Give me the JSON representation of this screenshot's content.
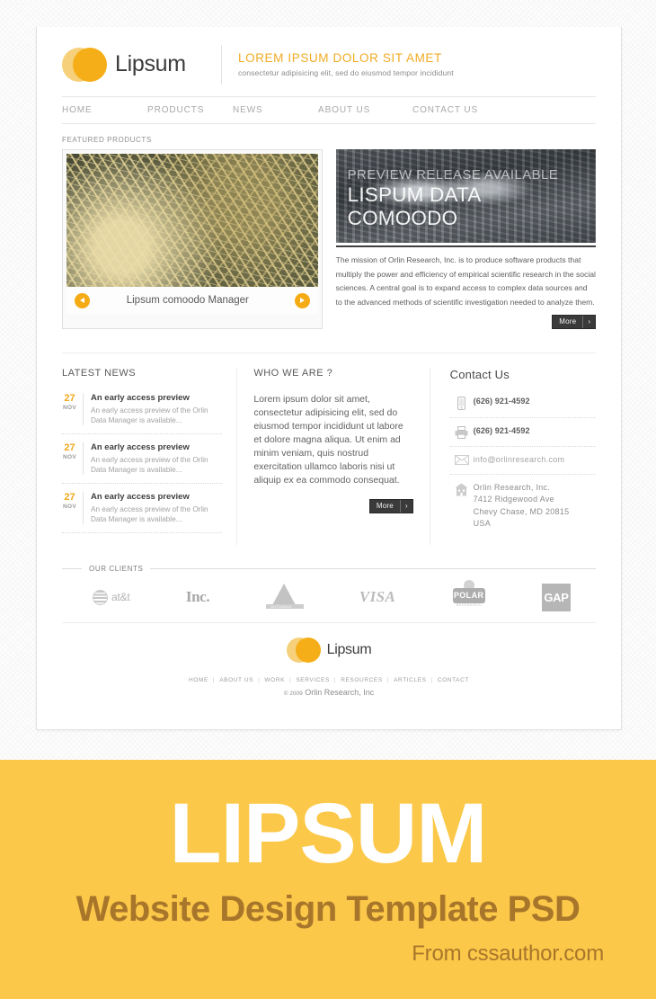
{
  "brand": {
    "name": "Lipsum"
  },
  "header": {
    "tagline_main": "LOREM IPSUM DOLOR SIT AMET",
    "tagline_sub": "consectetur adipisicing elit, sed do eiusmod tempor incididunt",
    "accent_color": "#efa81e"
  },
  "nav": {
    "items": [
      {
        "label": "HOME"
      },
      {
        "label": "PRODUCTS"
      },
      {
        "label": "NEWS"
      },
      {
        "label": "ABOUT US"
      },
      {
        "label": "CONTACT US"
      }
    ]
  },
  "featured": {
    "section_label": "FEATURED PRODUCTS",
    "slider": {
      "caption": "Lipsum comoodo Manager"
    },
    "promo": {
      "overline": "PREVIEW RELEASE AVAILABLE",
      "title_line1": "LISPUM DATA",
      "title_line2": "COMOODO",
      "body": "The mission of Orlin Research, Inc. is to produce software products that multiply the power and efficiency of empirical scientific research in the social sciences. A central goal is to expand access to complex data sources and to the advanced methods of scientific investigation needed to analyze them.",
      "more_label": "More",
      "more_chevron": "›"
    }
  },
  "news": {
    "heading": "LATEST NEWS",
    "items": [
      {
        "day": "27",
        "month": "NOV",
        "title": "An early access preview",
        "desc": "An early access preview of the Orlin Data Manager is available..."
      },
      {
        "day": "27",
        "month": "NOV",
        "title": "An early access preview",
        "desc": "An early access preview of the Orlin Data Manager is available..."
      },
      {
        "day": "27",
        "month": "NOV",
        "title": "An early access preview",
        "desc": "An early access preview of the Orlin Data Manager is available..."
      }
    ]
  },
  "who": {
    "heading": "WHO WE ARE ?",
    "body": "Lorem ipsum dolor sit amet, consectetur adipisicing elit, sed do eiusmod tempor incididunt ut labore et dolore magna aliqua. Ut enim ad minim veniam, quis nostrud exercitation ullamco laboris nisi ut aliquip ex ea commodo consequat.",
    "more_label": "More",
    "more_chevron": "›"
  },
  "contact": {
    "heading": "Contact Us",
    "phone": "(626) 921-4592",
    "fax": "(626) 921-4592",
    "email": "info@orlinresearch.com",
    "address_line1": "Orlin Research, Inc.",
    "address_line2": "7412 Ridgewood Ave",
    "address_line3": "Chevy Chase, MD 20815",
    "address_line4": "USA"
  },
  "clients": {
    "heading": "OUR CLIENTS",
    "logos": [
      {
        "name": "at&t",
        "label": "at&t"
      },
      {
        "name": "inc",
        "label": "Inc."
      },
      {
        "name": "automaxx",
        "label": "AUTOMAXX"
      },
      {
        "name": "visa",
        "label": "VISA"
      },
      {
        "name": "polar",
        "label": "POLAR",
        "sub": "BEVERAGES"
      },
      {
        "name": "gap",
        "label": "GAP"
      }
    ]
  },
  "footer": {
    "nav": [
      {
        "label": "HOME"
      },
      {
        "label": "ABOUT US"
      },
      {
        "label": "WORK"
      },
      {
        "label": "SERVICES"
      },
      {
        "label": "RESOURCES"
      },
      {
        "label": "ARTICLES"
      },
      {
        "label": "CONTACT"
      }
    ],
    "separator": "|",
    "copyright_symbol": "© 2009",
    "copyright_text": "Orlin Research, Inc"
  },
  "banner": {
    "title": "LIPSUM",
    "subtitle": "Website Design Template PSD",
    "from": "From cssauthor.com",
    "background": "#fbc849",
    "subtitle_color": "#a8762b"
  }
}
